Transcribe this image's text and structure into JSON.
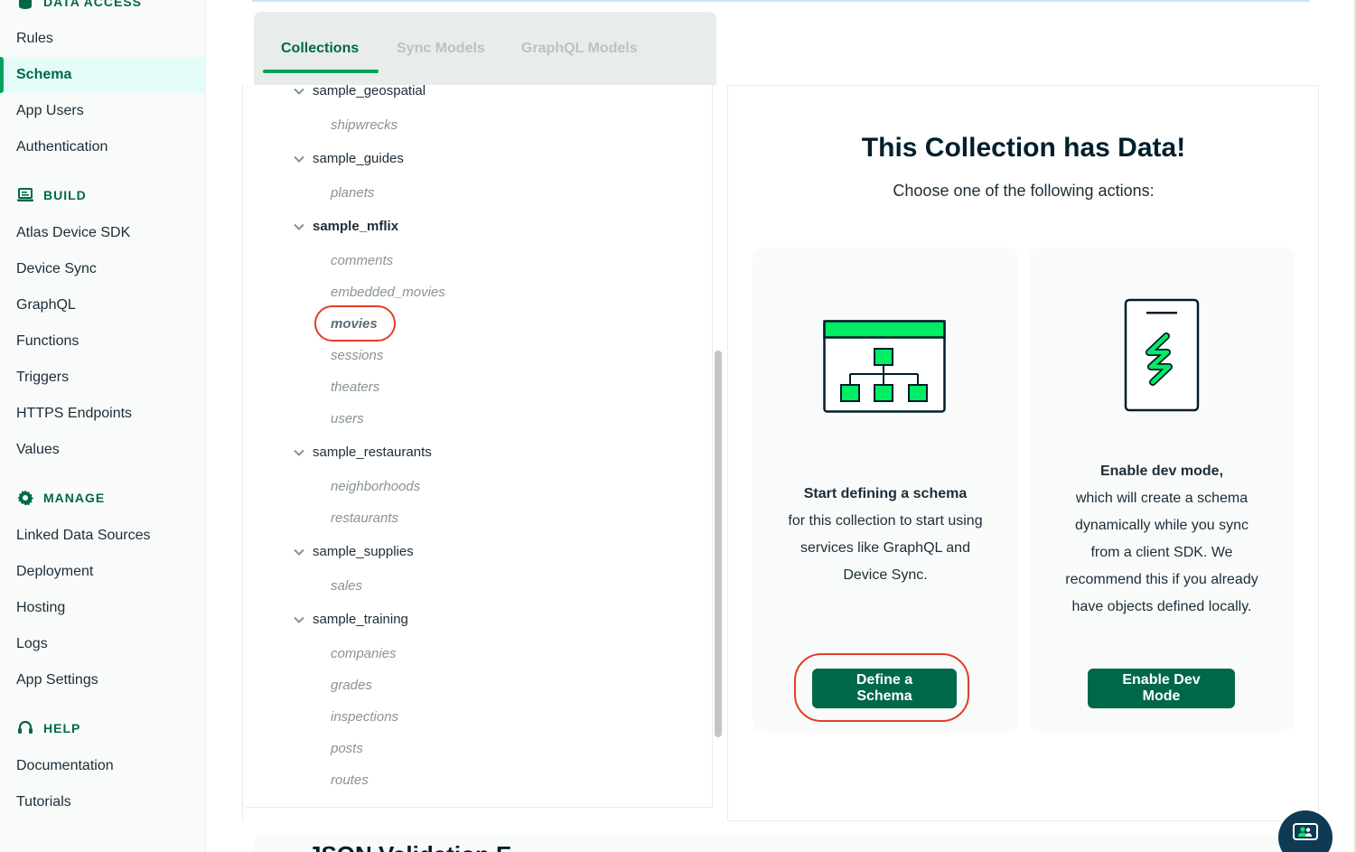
{
  "sidebar": {
    "data_access": {
      "header": "DATA ACCESS",
      "items": [
        "Rules",
        "Schema",
        "App Users",
        "Authentication"
      ],
      "active": "Schema"
    },
    "build": {
      "header": "BUILD",
      "items": [
        "Atlas Device SDK",
        "Device Sync",
        "GraphQL",
        "Functions",
        "Triggers",
        "HTTPS Endpoints",
        "Values"
      ]
    },
    "manage": {
      "header": "MANAGE",
      "items": [
        "Linked Data Sources",
        "Deployment",
        "Hosting",
        "Logs",
        "App Settings"
      ]
    },
    "help": {
      "header": "HELP",
      "items": [
        "Documentation",
        "Tutorials"
      ]
    }
  },
  "tabs": {
    "items": [
      "Collections",
      "Sync Models",
      "GraphQL Models"
    ],
    "active": "Collections"
  },
  "tree": [
    {
      "db": "sample_geospatial",
      "collections": [
        "shipwrecks"
      ]
    },
    {
      "db": "sample_guides",
      "collections": [
        "planets"
      ]
    },
    {
      "db": "sample_mflix",
      "collections": [
        "comments",
        "embedded_movies",
        "movies",
        "sessions",
        "theaters",
        "users"
      ],
      "expanded_bold": true,
      "selected": "movies"
    },
    {
      "db": "sample_restaurants",
      "collections": [
        "neighborhoods",
        "restaurants"
      ]
    },
    {
      "db": "sample_supplies",
      "collections": [
        "sales"
      ]
    },
    {
      "db": "sample_training",
      "collections": [
        "companies",
        "grades",
        "inspections",
        "posts",
        "routes"
      ]
    }
  ],
  "main": {
    "title": "This Collection has Data!",
    "subtitle": "Choose one of the following actions:",
    "card_schema": {
      "heading": "Start defining a schema",
      "lines": [
        "for this collection to start using",
        "services like GraphQL and",
        "Device Sync."
      ],
      "button": "Define a Schema",
      "icon": "schema-hierarchy-icon"
    },
    "card_dev": {
      "heading": "Enable dev mode,",
      "lines": [
        "which will create a schema",
        "dynamically while you sync",
        "from a client SDK. We",
        "recommend this if you already",
        "have objects defined locally."
      ],
      "button": "Enable Dev Mode",
      "icon": "mobile-sync-icon"
    }
  },
  "bottom": {
    "partial_heading": "JSON Validation E"
  },
  "colors": {
    "accent": "#00684a",
    "accent_bright": "#00ed64",
    "annotation": "#e43c28",
    "text_dark": "#001e2b"
  }
}
